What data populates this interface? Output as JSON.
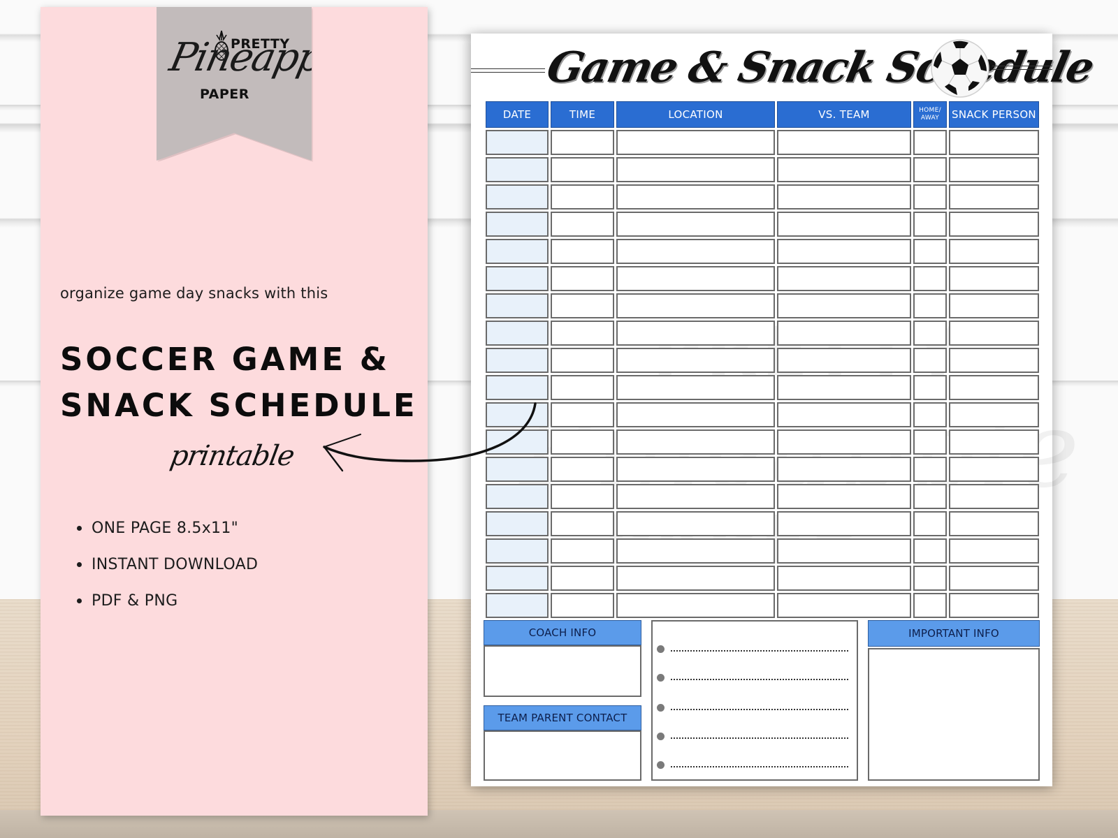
{
  "brand": {
    "line1": "PRETTY",
    "script": "Pineapple",
    "line3": "PAPER",
    "watermark_line1": "PRETTY",
    "watermark_line2": "Pineapple",
    "watermark_line3": "PAPER"
  },
  "promo": {
    "tagline": "organize game day snacks with this",
    "headline_line1": "SOCCER GAME &",
    "headline_line2": "SNACK SCHEDULE",
    "subtitle": "printable",
    "features": [
      "ONE PAGE 8.5x11\"",
      "INSTANT DOWNLOAD",
      "PDF & PNG"
    ],
    "colors": {
      "panel": "#fddbdd",
      "banner": "#c2bbbb"
    }
  },
  "printable": {
    "title": "Game & Snack Schedule",
    "icon": "soccer-ball-icon",
    "table": {
      "columns": [
        "DATE",
        "TIME",
        "LOCATION",
        "VS. TEAM",
        "HOME/ AWAY",
        "SNACK PERSON"
      ],
      "row_count": 18
    },
    "sections": {
      "coach_info": "COACH INFO",
      "team_parent_contact": "TEAM PARENT CONTACT",
      "important_info": "IMPORTANT INFO",
      "notes_lines": 5
    },
    "colors": {
      "header": "#2a6dd2",
      "section_header": "#5b9bea",
      "date_cell": "#e8f1fa"
    }
  }
}
